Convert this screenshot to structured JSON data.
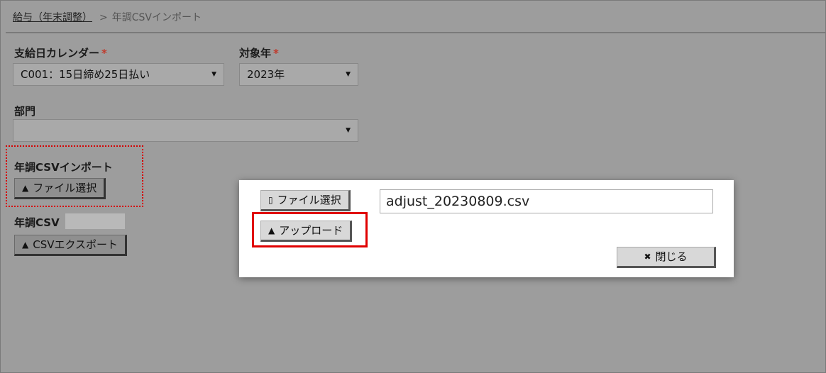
{
  "breadcrumb": {
    "parent": "給与（年末調整）",
    "separator": ">",
    "current": "年調CSVインポート"
  },
  "form": {
    "calendar_label": "支給日カレンダー",
    "calendar_value": "C001：15日締め25日払い",
    "year_label": "対象年",
    "year_value": "2023年",
    "required_mark": "*",
    "dept_label": "部門",
    "dept_value": "",
    "import_section_label": "年調CSVインポート",
    "file_select_button": "ファイル選択",
    "export_section_label": "年調CSV",
    "export_button": "CSVエクスポート"
  },
  "dialog": {
    "file_select_button": "ファイル選択",
    "file_name": "adjust_20230809.csv",
    "upload_button": "アップロード",
    "close_button": "閉じる"
  },
  "icons": {
    "upload": "upload-tray-icon",
    "file": "file-icon",
    "close": "x-icon",
    "caret": "caret-down-icon"
  },
  "colors": {
    "required": "#c0392b",
    "highlight": "#e00000"
  }
}
